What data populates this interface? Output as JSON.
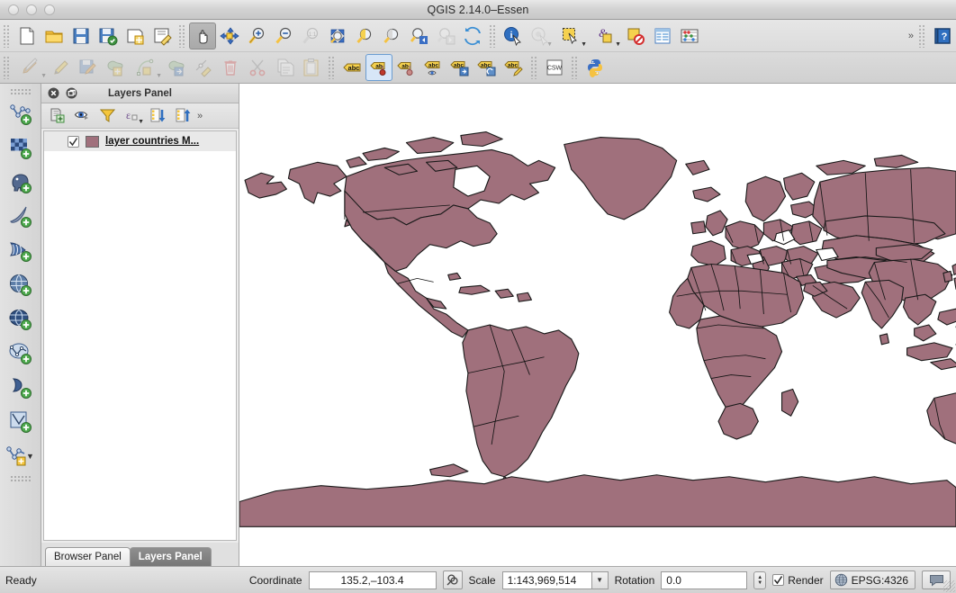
{
  "window": {
    "title": "QGIS 2.14.0–Essen",
    "traffic_lights": [
      "close-button",
      "minimize-button",
      "zoom-button"
    ]
  },
  "toolbars": {
    "row1": [
      {
        "icon": "new-project-icon",
        "label": "New Project",
        "state": "normal"
      },
      {
        "icon": "open-project-icon",
        "label": "Open Project",
        "state": "normal"
      },
      {
        "icon": "save-project-icon",
        "label": "Save Project",
        "state": "normal"
      },
      {
        "icon": "save-project-as-icon",
        "label": "Save Project As",
        "state": "normal"
      },
      {
        "icon": "new-print-composer-icon",
        "label": "New Print Composer",
        "state": "normal"
      },
      {
        "icon": "composer-manager-icon",
        "label": "Composer Manager",
        "state": "normal"
      },
      {
        "icon": "pan-map-icon",
        "label": "Pan Map",
        "state": "active"
      },
      {
        "icon": "pan-to-selection-icon",
        "label": "Pan Map to Selection",
        "state": "normal"
      },
      {
        "icon": "zoom-in-icon",
        "label": "Zoom In",
        "state": "normal"
      },
      {
        "icon": "zoom-out-icon",
        "label": "Zoom Out",
        "state": "normal"
      },
      {
        "icon": "zoom-native-icon",
        "label": "Zoom to Native Resolution",
        "state": "disabled"
      },
      {
        "icon": "zoom-full-icon",
        "label": "Zoom Full",
        "state": "normal"
      },
      {
        "icon": "zoom-to-selection-icon",
        "label": "Zoom to Selection",
        "state": "normal"
      },
      {
        "icon": "zoom-to-layer-icon",
        "label": "Zoom to Layer",
        "state": "normal"
      },
      {
        "icon": "zoom-last-icon",
        "label": "Zoom Last",
        "state": "normal"
      },
      {
        "icon": "zoom-next-icon",
        "label": "Zoom Next",
        "state": "disabled"
      },
      {
        "icon": "refresh-icon",
        "label": "Refresh",
        "state": "normal"
      },
      {
        "icon": "identify-features-icon",
        "label": "Identify Features",
        "state": "normal"
      },
      {
        "icon": "map-tips-icon",
        "label": "Show Map Tips",
        "state": "disabled"
      },
      {
        "icon": "select-features-icon",
        "label": "Select Features by Area or Single Click",
        "state": "normal"
      },
      {
        "icon": "select-by-expression-icon",
        "label": "Select Features by Expression",
        "state": "normal"
      },
      {
        "icon": "deselect-all-icon",
        "label": "Deselect Features from All Layers",
        "state": "normal"
      },
      {
        "icon": "attribute-table-icon",
        "label": "Open Attribute Table",
        "state": "normal"
      },
      {
        "icon": "field-calculator-icon",
        "label": "Open Field Calculator",
        "state": "normal"
      },
      {
        "icon": "overflow-icon",
        "label": "More toolbar items",
        "state": "normal"
      },
      {
        "icon": "help-icon",
        "label": "Help",
        "state": "normal"
      }
    ],
    "row2": [
      {
        "icon": "current-edits-icon",
        "label": "Current Edits",
        "state": "disabled"
      },
      {
        "icon": "toggle-editing-icon",
        "label": "Toggle Editing",
        "state": "disabled"
      },
      {
        "icon": "save-layer-edits-icon",
        "label": "Save Layer Edits",
        "state": "disabled"
      },
      {
        "icon": "add-feature-icon",
        "label": "Add Feature",
        "state": "disabled"
      },
      {
        "icon": "add-circular-string-icon",
        "label": "Add Circular String",
        "state": "disabled"
      },
      {
        "icon": "move-feature-icon",
        "label": "Move Feature",
        "state": "disabled"
      },
      {
        "icon": "node-tool-icon",
        "label": "Node Tool",
        "state": "disabled"
      },
      {
        "icon": "delete-selected-icon",
        "label": "Delete Selected",
        "state": "disabled"
      },
      {
        "icon": "cut-features-icon",
        "label": "Cut Features",
        "state": "disabled"
      },
      {
        "icon": "copy-features-icon",
        "label": "Copy Features",
        "state": "disabled"
      },
      {
        "icon": "paste-features-icon",
        "label": "Paste Features",
        "state": "disabled"
      },
      {
        "icon": "label-icon",
        "label": "Layer Labeling Options",
        "state": "normal"
      },
      {
        "icon": "pin-labels-icon",
        "label": "Pin/Unpin Labels and Diagrams",
        "state": "selected"
      },
      {
        "icon": "show-pinned-labels-icon",
        "label": "Show Pinned Labels",
        "state": "normal"
      },
      {
        "icon": "highlight-labels-icon",
        "label": "Highlight Pinned Labels",
        "state": "normal"
      },
      {
        "icon": "move-label-icon",
        "label": "Move Label or Diagram",
        "state": "normal"
      },
      {
        "icon": "rotate-label-icon",
        "label": "Rotate Label",
        "state": "normal"
      },
      {
        "icon": "change-label-icon",
        "label": "Change Label",
        "state": "normal"
      },
      {
        "icon": "csw-icon",
        "label": "MetaSearch (CSW Client)",
        "state": "normal"
      },
      {
        "icon": "python-console-icon",
        "label": "Python Console",
        "state": "normal"
      }
    ]
  },
  "manage_layers_toolbar": [
    {
      "icon": "add-vector-layer-icon",
      "label": "Add Vector Layer"
    },
    {
      "icon": "add-raster-layer-icon",
      "label": "Add Raster Layer"
    },
    {
      "icon": "add-postgis-layer-icon",
      "label": "Add PostGIS Layer"
    },
    {
      "icon": "add-spatialite-layer-icon",
      "label": "Add SpatiaLite Layer"
    },
    {
      "icon": "add-mssql-layer-icon",
      "label": "Add MSSQL Spatial Layer"
    },
    {
      "icon": "add-oracle-layer-icon",
      "label": "Add Oracle Spatial Layer"
    },
    {
      "icon": "add-wms-layer-icon",
      "label": "Add WMS/WMTS Layer"
    },
    {
      "icon": "add-delimited-text-layer-icon",
      "label": "Add Delimited Text Layer"
    },
    {
      "icon": "add-wfs-layer-icon",
      "label": "Add WFS Layer"
    },
    {
      "icon": "new-vector-layer-icon",
      "label": "New Vector Layer"
    }
  ],
  "layers_panel": {
    "title": "Layers Panel",
    "close_label": "Close panel",
    "float_label": "Float panel",
    "toolbar": [
      {
        "icon": "add-group-icon",
        "label": "Add Group"
      },
      {
        "icon": "manage-layer-visibility-icon",
        "label": "Manage Layer Visibility"
      },
      {
        "icon": "filter-legend-icon",
        "label": "Filter Legend by Map Content"
      },
      {
        "icon": "filter-legend-expression-icon",
        "label": "Filter Legend by Expression"
      },
      {
        "icon": "expand-all-icon",
        "label": "Expand All"
      },
      {
        "icon": "collapse-all-icon",
        "label": "Collapse All"
      },
      {
        "icon": "overflow-icon",
        "label": "More"
      }
    ],
    "layers": [
      {
        "name": "layer countries M...",
        "checked": true,
        "swatch_color": "#a0707c"
      }
    ]
  },
  "panel_tabs": [
    {
      "label": "Browser Panel",
      "active": false
    },
    {
      "label": "Layers Panel",
      "active": true
    }
  ],
  "map": {
    "fill_color": "#a0707c",
    "stroke_color": "#1a1a1a",
    "background_color": "#ffffff"
  },
  "statusbar": {
    "status_text": "Ready",
    "coordinate_label": "Coordinate",
    "coordinate_value": "135.2,–103.4",
    "coordinate_toggle_icon": "coordinate-capture-icon",
    "scale_label": "Scale",
    "scale_value": "1:143,969,514",
    "rotation_label": "Rotation",
    "rotation_value": "0.0",
    "render_label": "Render",
    "render_checked": true,
    "crs_label": "EPSG:4326",
    "crs_icon": "globe-icon",
    "messages_icon": "messages-icon"
  }
}
